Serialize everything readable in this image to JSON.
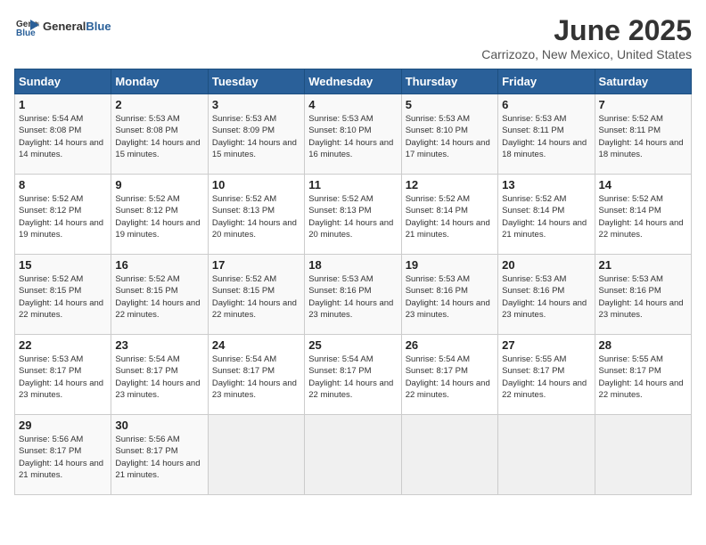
{
  "header": {
    "logo_general": "General",
    "logo_blue": "Blue",
    "title": "June 2025",
    "subtitle": "Carrizozo, New Mexico, United States"
  },
  "weekdays": [
    "Sunday",
    "Monday",
    "Tuesday",
    "Wednesday",
    "Thursday",
    "Friday",
    "Saturday"
  ],
  "weeks": [
    [
      {
        "day": "1",
        "sunrise": "Sunrise: 5:54 AM",
        "sunset": "Sunset: 8:08 PM",
        "daylight": "Daylight: 14 hours and 14 minutes."
      },
      {
        "day": "2",
        "sunrise": "Sunrise: 5:53 AM",
        "sunset": "Sunset: 8:08 PM",
        "daylight": "Daylight: 14 hours and 15 minutes."
      },
      {
        "day": "3",
        "sunrise": "Sunrise: 5:53 AM",
        "sunset": "Sunset: 8:09 PM",
        "daylight": "Daylight: 14 hours and 15 minutes."
      },
      {
        "day": "4",
        "sunrise": "Sunrise: 5:53 AM",
        "sunset": "Sunset: 8:10 PM",
        "daylight": "Daylight: 14 hours and 16 minutes."
      },
      {
        "day": "5",
        "sunrise": "Sunrise: 5:53 AM",
        "sunset": "Sunset: 8:10 PM",
        "daylight": "Daylight: 14 hours and 17 minutes."
      },
      {
        "day": "6",
        "sunrise": "Sunrise: 5:53 AM",
        "sunset": "Sunset: 8:11 PM",
        "daylight": "Daylight: 14 hours and 18 minutes."
      },
      {
        "day": "7",
        "sunrise": "Sunrise: 5:52 AM",
        "sunset": "Sunset: 8:11 PM",
        "daylight": "Daylight: 14 hours and 18 minutes."
      }
    ],
    [
      {
        "day": "8",
        "sunrise": "Sunrise: 5:52 AM",
        "sunset": "Sunset: 8:12 PM",
        "daylight": "Daylight: 14 hours and 19 minutes."
      },
      {
        "day": "9",
        "sunrise": "Sunrise: 5:52 AM",
        "sunset": "Sunset: 8:12 PM",
        "daylight": "Daylight: 14 hours and 19 minutes."
      },
      {
        "day": "10",
        "sunrise": "Sunrise: 5:52 AM",
        "sunset": "Sunset: 8:13 PM",
        "daylight": "Daylight: 14 hours and 20 minutes."
      },
      {
        "day": "11",
        "sunrise": "Sunrise: 5:52 AM",
        "sunset": "Sunset: 8:13 PM",
        "daylight": "Daylight: 14 hours and 20 minutes."
      },
      {
        "day": "12",
        "sunrise": "Sunrise: 5:52 AM",
        "sunset": "Sunset: 8:14 PM",
        "daylight": "Daylight: 14 hours and 21 minutes."
      },
      {
        "day": "13",
        "sunrise": "Sunrise: 5:52 AM",
        "sunset": "Sunset: 8:14 PM",
        "daylight": "Daylight: 14 hours and 21 minutes."
      },
      {
        "day": "14",
        "sunrise": "Sunrise: 5:52 AM",
        "sunset": "Sunset: 8:14 PM",
        "daylight": "Daylight: 14 hours and 22 minutes."
      }
    ],
    [
      {
        "day": "15",
        "sunrise": "Sunrise: 5:52 AM",
        "sunset": "Sunset: 8:15 PM",
        "daylight": "Daylight: 14 hours and 22 minutes."
      },
      {
        "day": "16",
        "sunrise": "Sunrise: 5:52 AM",
        "sunset": "Sunset: 8:15 PM",
        "daylight": "Daylight: 14 hours and 22 minutes."
      },
      {
        "day": "17",
        "sunrise": "Sunrise: 5:52 AM",
        "sunset": "Sunset: 8:15 PM",
        "daylight": "Daylight: 14 hours and 22 minutes."
      },
      {
        "day": "18",
        "sunrise": "Sunrise: 5:53 AM",
        "sunset": "Sunset: 8:16 PM",
        "daylight": "Daylight: 14 hours and 23 minutes."
      },
      {
        "day": "19",
        "sunrise": "Sunrise: 5:53 AM",
        "sunset": "Sunset: 8:16 PM",
        "daylight": "Daylight: 14 hours and 23 minutes."
      },
      {
        "day": "20",
        "sunrise": "Sunrise: 5:53 AM",
        "sunset": "Sunset: 8:16 PM",
        "daylight": "Daylight: 14 hours and 23 minutes."
      },
      {
        "day": "21",
        "sunrise": "Sunrise: 5:53 AM",
        "sunset": "Sunset: 8:16 PM",
        "daylight": "Daylight: 14 hours and 23 minutes."
      }
    ],
    [
      {
        "day": "22",
        "sunrise": "Sunrise: 5:53 AM",
        "sunset": "Sunset: 8:17 PM",
        "daylight": "Daylight: 14 hours and 23 minutes."
      },
      {
        "day": "23",
        "sunrise": "Sunrise: 5:54 AM",
        "sunset": "Sunset: 8:17 PM",
        "daylight": "Daylight: 14 hours and 23 minutes."
      },
      {
        "day": "24",
        "sunrise": "Sunrise: 5:54 AM",
        "sunset": "Sunset: 8:17 PM",
        "daylight": "Daylight: 14 hours and 23 minutes."
      },
      {
        "day": "25",
        "sunrise": "Sunrise: 5:54 AM",
        "sunset": "Sunset: 8:17 PM",
        "daylight": "Daylight: 14 hours and 22 minutes."
      },
      {
        "day": "26",
        "sunrise": "Sunrise: 5:54 AM",
        "sunset": "Sunset: 8:17 PM",
        "daylight": "Daylight: 14 hours and 22 minutes."
      },
      {
        "day": "27",
        "sunrise": "Sunrise: 5:55 AM",
        "sunset": "Sunset: 8:17 PM",
        "daylight": "Daylight: 14 hours and 22 minutes."
      },
      {
        "day": "28",
        "sunrise": "Sunrise: 5:55 AM",
        "sunset": "Sunset: 8:17 PM",
        "daylight": "Daylight: 14 hours and 22 minutes."
      }
    ],
    [
      {
        "day": "29",
        "sunrise": "Sunrise: 5:56 AM",
        "sunset": "Sunset: 8:17 PM",
        "daylight": "Daylight: 14 hours and 21 minutes."
      },
      {
        "day": "30",
        "sunrise": "Sunrise: 5:56 AM",
        "sunset": "Sunset: 8:17 PM",
        "daylight": "Daylight: 14 hours and 21 minutes."
      },
      null,
      null,
      null,
      null,
      null
    ]
  ]
}
